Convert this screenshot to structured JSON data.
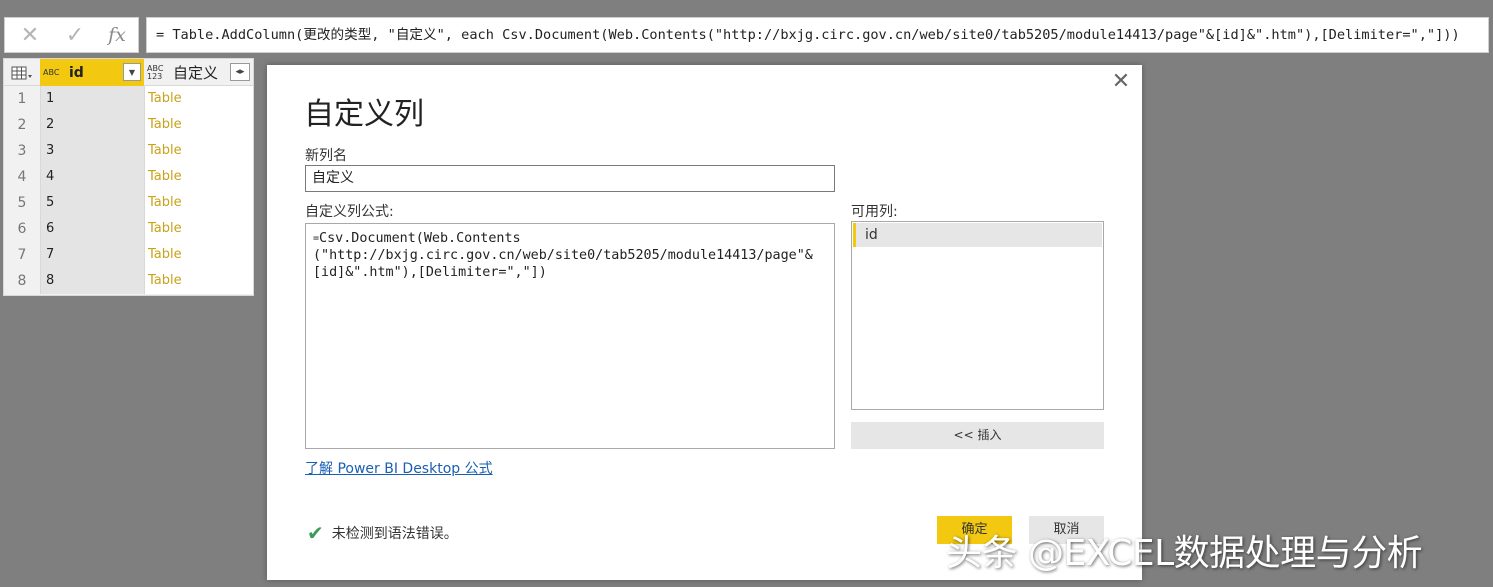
{
  "formula_bar": {
    "cancel_icon": "✕",
    "commit_icon": "✓",
    "fx_label": "fx",
    "formula": "= Table.AddColumn(更改的类型, \"自定义\", each Csv.Document(Web.Contents(\"http://bxjg.circ.gov.cn/web/site0/tab5205/module14413/page\"&[id]&\".htm\"),[Delimiter=\",\"]))"
  },
  "grid": {
    "columns": [
      {
        "name": "id",
        "type_badge": "ABC"
      },
      {
        "name": "自定义",
        "type_badge": "ABC 123"
      }
    ],
    "rows": [
      {
        "num": "1",
        "id": "1",
        "value": "Table"
      },
      {
        "num": "2",
        "id": "2",
        "value": "Table"
      },
      {
        "num": "3",
        "id": "3",
        "value": "Table"
      },
      {
        "num": "4",
        "id": "4",
        "value": "Table"
      },
      {
        "num": "5",
        "id": "5",
        "value": "Table"
      },
      {
        "num": "6",
        "id": "6",
        "value": "Table"
      },
      {
        "num": "7",
        "id": "7",
        "value": "Table"
      },
      {
        "num": "8",
        "id": "8",
        "value": "Table"
      }
    ]
  },
  "dialog": {
    "title": "自定义列",
    "new_column_label": "新列名",
    "new_column_value": "自定义",
    "formula_label": "自定义列公式:",
    "formula_prefix": "=",
    "formula_value": "Csv.Document(Web.Contents\n(\"http://bxjg.circ.gov.cn/web/site0/tab5205/module14413/page\"&\n[id]&\".htm\"),[Delimiter=\",\"])",
    "available_columns_label": "可用列:",
    "available_columns": [
      "id"
    ],
    "insert_button": "<< 插入",
    "learn_link": "了解 Power BI Desktop 公式",
    "status_text": "未检测到语法错误。",
    "ok_button": "确定",
    "cancel_button": "取消"
  },
  "watermark": "头条 @EXCEL数据处理与分析",
  "colors": {
    "accent": "#f2c811",
    "background": "#7f7f7f",
    "link": "#1a5fb4",
    "success": "#3c9c57",
    "table_value": "#c8a21a"
  }
}
